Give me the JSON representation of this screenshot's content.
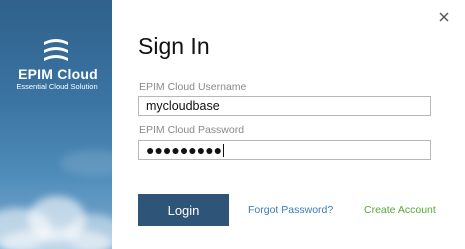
{
  "brand": {
    "name": "EPIM Cloud",
    "tagline": "Essential Cloud Solution",
    "logo_icon": "epim-logo-icon"
  },
  "window": {
    "close_icon": "close-icon",
    "close_symbol": "×"
  },
  "form": {
    "title": "Sign In",
    "username_label": "EPIM Cloud Username",
    "username_value": "mycloudbase",
    "password_label": "EPIM Cloud Password",
    "password_mask": "●●●●●●●●●"
  },
  "actions": {
    "login_label": "Login",
    "forgot_label": "Forgot Password?",
    "create_label": "Create Account"
  },
  "colors": {
    "sidebar": "#3b75a4",
    "button": "#2e5478",
    "forgot_link": "#3f7ab5",
    "create_link": "#58a83a"
  }
}
